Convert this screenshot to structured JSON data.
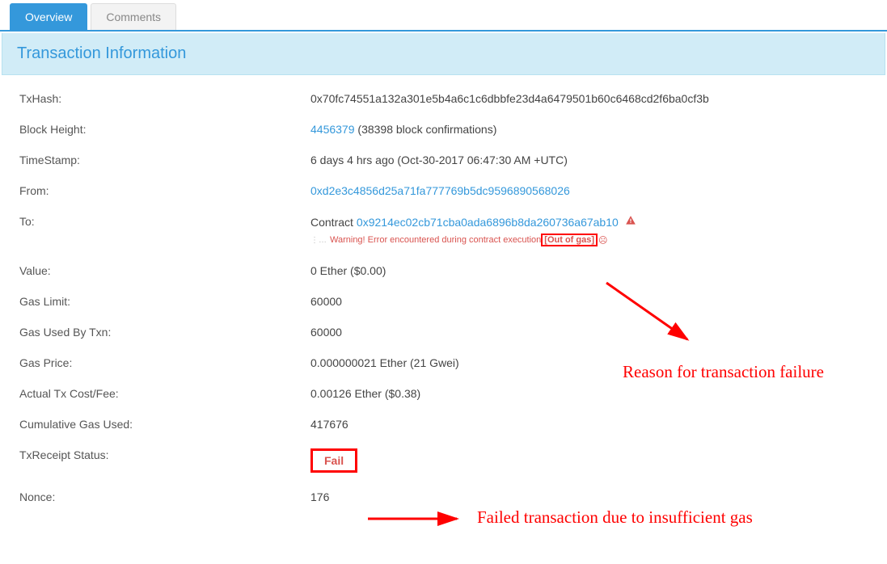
{
  "tabs": {
    "overview": "Overview",
    "comments": "Comments"
  },
  "panel_title": "Transaction Information",
  "fields": {
    "txhash_label": "TxHash:",
    "txhash_value": "0x70fc74551a132a301e5b4a6c1c6dbbfe23d4a6479501b60c6468cd2f6ba0cf3b",
    "blockheight_label": "Block Height:",
    "blockheight_link": "4456379",
    "blockheight_confirm": " (38398 block confirmations)",
    "timestamp_label": "TimeStamp:",
    "timestamp_value": "6 days 4 hrs ago (Oct-30-2017 06:47:30 AM +UTC)",
    "from_label": "From:",
    "from_value": "0xd2e3c4856d25a71fa777769b5dc9596890568026",
    "to_label": "To:",
    "to_contract_prefix": "Contract ",
    "to_contract_address": "0x9214ec02cb71cba0ada6896b8da260736a67ab10",
    "to_error_prefix": "⋮… ",
    "to_error_main": "Warning! Error encountered during contract execution ",
    "to_error_reason": "[Out of gas]",
    "value_label": "Value:",
    "value_value": "0 Ether ($0.00)",
    "gaslimit_label": "Gas Limit:",
    "gaslimit_value": "60000",
    "gasused_label": "Gas Used By Txn:",
    "gasused_value": "60000",
    "gasprice_label": "Gas Price:",
    "gasprice_value": "0.000000021 Ether (21 Gwei)",
    "cost_label": "Actual Tx Cost/Fee:",
    "cost_value": "0.00126 Ether ($0.38)",
    "cumgas_label": "Cumulative Gas Used:",
    "cumgas_value": "417676",
    "receipt_label": "TxReceipt Status:",
    "receipt_value": "Fail",
    "nonce_label": "Nonce:",
    "nonce_value": "176"
  },
  "annotations": {
    "reason": "Reason for transaction failure",
    "failed": "Failed transaction due to insufficient gas"
  }
}
